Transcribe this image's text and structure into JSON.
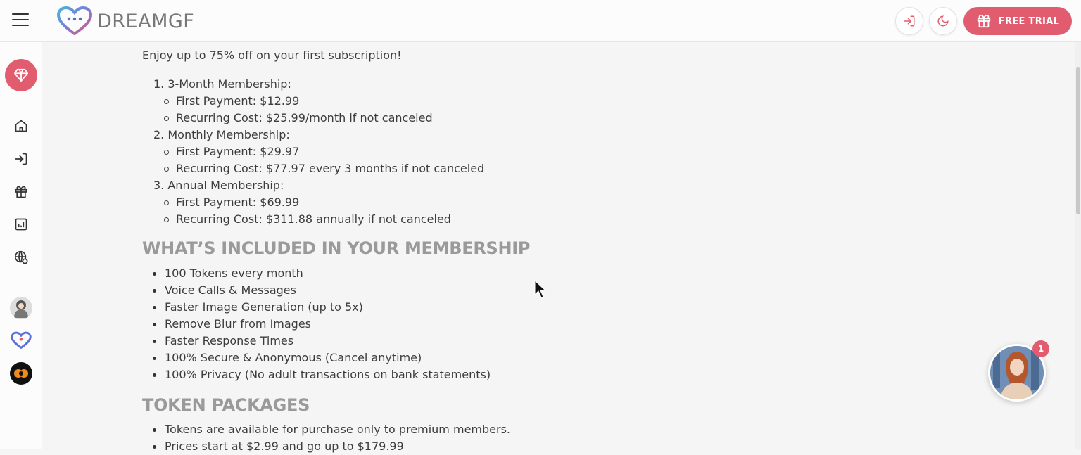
{
  "header": {
    "brand": "DREAMGF",
    "trial_label": "FREE TRIAL"
  },
  "main": {
    "faded_title": "",
    "intro": "Enjoy up to 75% off on your first subscription!",
    "plans": [
      {
        "num": "1",
        "name": "3-Month Membership:",
        "first": "First Payment: $12.99",
        "recurring": "Recurring Cost: $25.99/month if not canceled"
      },
      {
        "num": "2",
        "name": "Monthly Membership:",
        "first": "First Payment: $29.97",
        "recurring": "Recurring Cost: $77.97 every 3 months if not canceled"
      },
      {
        "num": "3",
        "name": "Annual Membership:",
        "first": "First Payment: $69.99",
        "recurring": "Recurring Cost: $311.88 annually if not canceled"
      }
    ],
    "included_title": "WHAT’S INCLUDED IN YOUR MEMBERSHIP",
    "included": [
      "100 Tokens every month",
      "Voice Calls & Messages",
      "Faster Image Generation (up to 5x)",
      "Remove Blur from Images",
      "Faster Response Times",
      "100% Secure & Anonymous (Cancel anytime)",
      "100% Privacy (No adult transactions on bank statements)"
    ],
    "tokens_title": "TOKEN PACKAGES",
    "tokens": [
      "Tokens are available for purchase only to premium members.",
      "Prices start at $2.99 and go up to $179.99"
    ]
  },
  "chat": {
    "badge": "1"
  },
  "colors": {
    "accent": "#e25c6f",
    "heading": "#9a9a9a"
  },
  "icons": [
    "menu-icon",
    "heart-logo-icon",
    "login-icon",
    "moon-icon",
    "gift-icon",
    "diamond-icon",
    "home-icon",
    "chart-icon",
    "globe-icon"
  ]
}
